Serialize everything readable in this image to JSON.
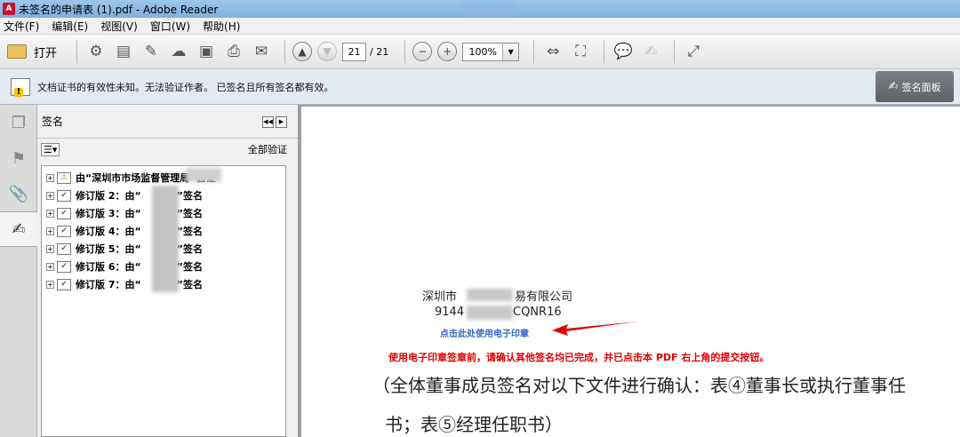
{
  "window": {
    "title": "未签名的申请表 (1).pdf - Adobe Reader",
    "app_icon_glyph": "A"
  },
  "menu": [
    "文件(F)",
    "编辑(E)",
    "视图(V)",
    "窗口(W)",
    "帮助(H)"
  ],
  "toolbar": {
    "open_label": "打开",
    "page_current": "21",
    "page_total": "/ 21",
    "zoom": "100%"
  },
  "notice": {
    "message": "文档证书的有效性未知。无法验证作者。 已签名且所有签名都有效。",
    "panel_button": "签名面板"
  },
  "signatures_panel": {
    "title": "签名",
    "verify_all": "全部验证",
    "items": [
      {
        "label": "由“深圳市市场监督管理局”验证",
        "status": "warning"
      },
      {
        "label": "修订版 2：由“",
        "suffix": "”签名",
        "status": "valid"
      },
      {
        "label": "修订版 3：由“",
        "suffix": "”签名",
        "status": "valid"
      },
      {
        "label": "修订版 4：由“",
        "suffix": "”签名",
        "status": "valid"
      },
      {
        "label": "修订版 5：由“",
        "suffix": "”签名",
        "status": "valid"
      },
      {
        "label": "修订版 6：由“",
        "suffix": "”签名",
        "status": "valid"
      },
      {
        "label": "修订版 7：由“",
        "suffix": "”签名",
        "status": "valid"
      }
    ]
  },
  "document": {
    "company": "深圳市",
    "company_suffix": "易有限公司",
    "code_prefix": "9144",
    "code_suffix": "CQNR16",
    "stamp_link": "点击此处使用电子印章",
    "warning": "使用电子印章签章前，请确认其他签名均已完成，并已点击本 PDF 右上角的提交按钮。",
    "line1": "（全体董事成员签名对以下文件进行确认：表④董事长或执行董事任",
    "line2": "书；表⑤经理任职书）"
  },
  "colors": {
    "link": "#3366cc",
    "warning_red": "#e00000",
    "arrow": "#e00000"
  }
}
